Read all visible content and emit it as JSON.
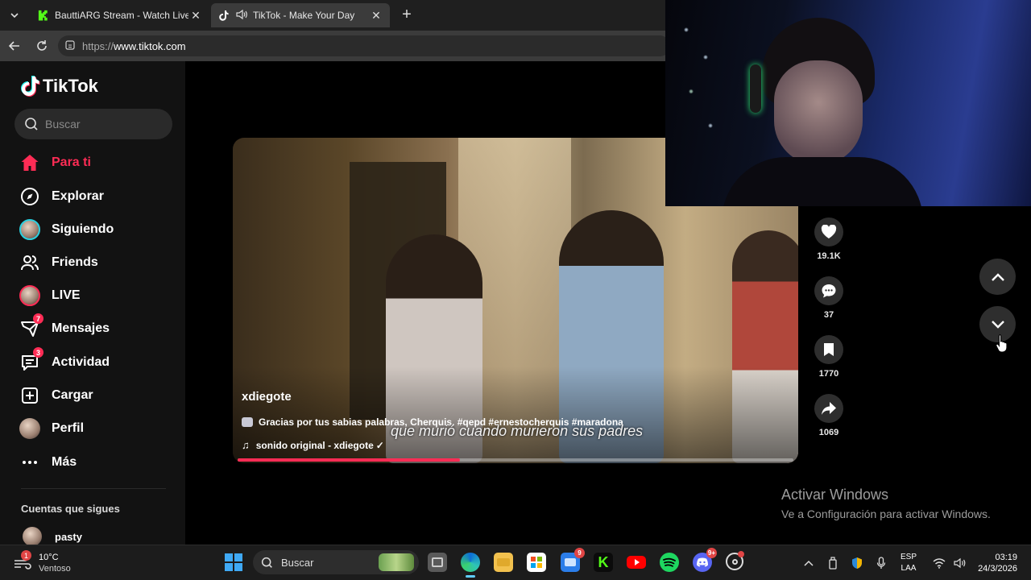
{
  "browser": {
    "tabs": [
      {
        "label": "BauttiARG Stream - Watch Live on",
        "favicon": "kick-icon",
        "active": false
      },
      {
        "label": "TikTok - Make Your Day",
        "favicon": "tiktok-icon",
        "active": true,
        "audio": true
      }
    ],
    "url_scheme": "https://",
    "url_host": "www.tiktok.com"
  },
  "sidebar": {
    "logo": "TikTok",
    "search_placeholder": "Buscar",
    "nav": [
      {
        "label": "Para ti",
        "icon": "home-icon",
        "active": true
      },
      {
        "label": "Explorar",
        "icon": "compass-icon"
      },
      {
        "label": "Siguiendo",
        "icon": "avatar"
      },
      {
        "label": "Friends",
        "icon": "friends-icon"
      },
      {
        "label": "LIVE",
        "icon": "avatar"
      },
      {
        "label": "Mensajes",
        "icon": "inbox-icon",
        "badge": "7"
      },
      {
        "label": "Actividad",
        "icon": "activity-icon",
        "badge": "3"
      },
      {
        "label": "Cargar",
        "icon": "upload-icon"
      },
      {
        "label": "Perfil",
        "icon": "avatar"
      },
      {
        "label": "Más",
        "icon": "more-icon"
      }
    ],
    "following_title": "Cuentas que sigues",
    "following": [
      {
        "name": "pasty"
      }
    ]
  },
  "video": {
    "author": "xdiegote",
    "description": "Gracias por tus sabias palabras, Cherquis. #qepd #ernestocherquis #maradona",
    "sound": "sonido original - xdiegote",
    "subtitle": "que murió cuando murieron sus padres",
    "progress": 0.4,
    "actions": [
      {
        "name": "like",
        "icon": "heart-icon",
        "count": "19.1K"
      },
      {
        "name": "comment",
        "icon": "comment-icon",
        "count": "37"
      },
      {
        "name": "save",
        "icon": "bookmark-icon",
        "count": "1770"
      },
      {
        "name": "share",
        "icon": "share-icon",
        "count": "1069"
      }
    ]
  },
  "watermark": {
    "title": "Activar Windows",
    "subtitle": "Ve a Configuración para activar Windows."
  },
  "taskbar": {
    "weather_temp": "10°C",
    "weather_desc": "Ventoso",
    "weather_badge": "1",
    "search_label": "Buscar",
    "apps": [
      {
        "name": "file-explorer-window",
        "badge": ""
      },
      {
        "name": "edge",
        "badge": ""
      },
      {
        "name": "folder",
        "badge": ""
      },
      {
        "name": "store",
        "badge": ""
      },
      {
        "name": "messaging",
        "badge": "9"
      },
      {
        "name": "kick",
        "badge": ""
      },
      {
        "name": "youtube",
        "badge": ""
      },
      {
        "name": "spotify",
        "badge": ""
      },
      {
        "name": "discord",
        "badge": "9+"
      },
      {
        "name": "steam",
        "badge": ""
      }
    ],
    "lang_line1": "ESP",
    "lang_line2": "LAA",
    "time": "03:19",
    "date": "24/3/2026"
  },
  "colors": {
    "accent": "#fe2c55",
    "chrome_dark": "#1f1f1f",
    "chrome_mid": "#3b3b3b",
    "sidebar_bg": "#121212"
  }
}
